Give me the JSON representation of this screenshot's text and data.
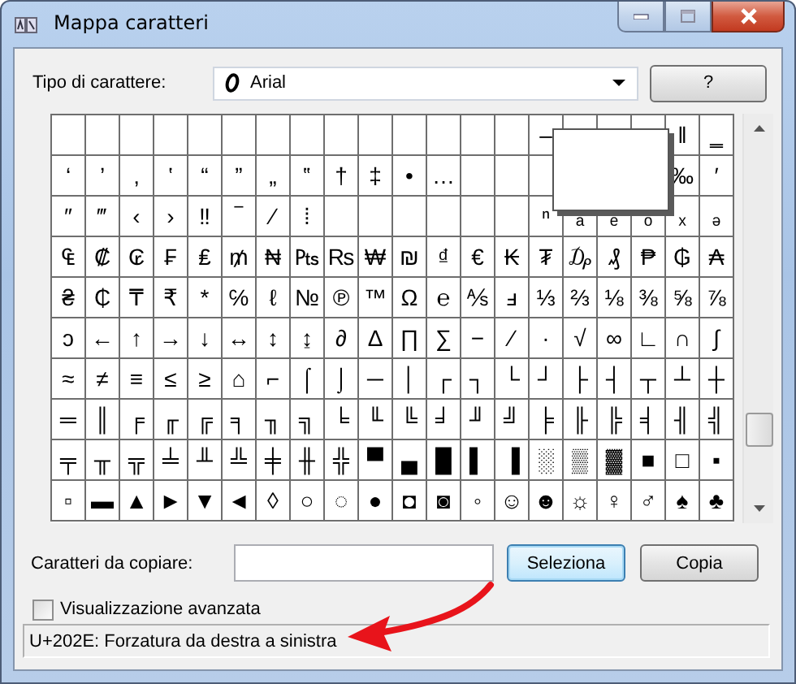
{
  "window": {
    "title": "Mappa caratteri"
  },
  "font": {
    "label": "Tipo di carattere:",
    "value": "Arial"
  },
  "help_button": "?",
  "grid": {
    "rows": [
      [
        null,
        null,
        null,
        null,
        null,
        null,
        null,
        null,
        null,
        null,
        null,
        null,
        null,
        null,
        "‒",
        null,
        null,
        null,
        "‖",
        "‗"
      ],
      [
        "‘",
        "’",
        "‚",
        "‛",
        "“",
        "”",
        "„",
        "‟",
        "†",
        "‡",
        "•",
        "…",
        null,
        null,
        null,
        null,
        null,
        null,
        "‰",
        "′"
      ],
      [
        "″",
        "‴",
        "‹",
        "›",
        "‼",
        "‾",
        "⁄",
        "⁞",
        null,
        null,
        null,
        null,
        null,
        null,
        "ⁿ",
        "ₐ",
        "ₑ",
        "ₒ",
        "ₓ",
        "ₔ"
      ],
      [
        "₠",
        "₡",
        "₢",
        "₣",
        "₤",
        "₥",
        "₦",
        "₧",
        "₨",
        "₩",
        "₪",
        "₫",
        "€",
        "₭",
        "₮",
        "₯",
        "₰",
        "₱",
        "₲",
        "₳"
      ],
      [
        "₴",
        "₵",
        "₸",
        "₹",
        "*",
        "℅",
        "ℓ",
        "№",
        "℗",
        "™",
        "Ω",
        "℮",
        "⅍",
        "ⅎ",
        "⅓",
        "⅔",
        "⅛",
        "⅜",
        "⅝",
        "⅞"
      ],
      [
        "ↄ",
        "←",
        "↑",
        "→",
        "↓",
        "↔",
        "↕",
        "↨",
        "∂",
        "∆",
        "∏",
        "∑",
        "−",
        "∕",
        "∙",
        "√",
        "∞",
        "∟",
        "∩",
        "∫"
      ],
      [
        "≈",
        "≠",
        "≡",
        "≤",
        "≥",
        "⌂",
        "⌐",
        "⌠",
        "⌡",
        "─",
        "│",
        "┌",
        "┐",
        "└",
        "┘",
        "├",
        "┤",
        "┬",
        "┴",
        "┼"
      ],
      [
        "═",
        "║",
        "╒",
        "╓",
        "╔",
        "╕",
        "╖",
        "╗",
        "╘",
        "╙",
        "╚",
        "╛",
        "╜",
        "╝",
        "╞",
        "╟",
        "╠",
        "╡",
        "╢",
        "╣"
      ],
      [
        "╤",
        "╥",
        "╦",
        "╧",
        "╨",
        "╩",
        "╪",
        "╫",
        "╬",
        "▀",
        "▄",
        "█",
        "▌",
        "▐",
        "░",
        "▒",
        "▓",
        "■",
        "□",
        "▪"
      ],
      [
        "▫",
        "▬",
        "▲",
        "►",
        "▼",
        "◄",
        "◊",
        "○",
        "◌",
        "●",
        "◘",
        "◙",
        "◦",
        "☺",
        "☻",
        "☼",
        "♀",
        "♂",
        "♠",
        "♣"
      ]
    ],
    "magnifier_shown": true
  },
  "copy": {
    "label": "Caratteri da copiare:"
  },
  "buttons": [
    {
      "label": "Seleziona",
      "focused": true
    },
    {
      "label": "Copia",
      "focused": false
    }
  ],
  "advanced": {
    "label": "Visualizzazione avanzata",
    "checked": false
  },
  "status_bar": "U+202E: Forzatura da destra a sinistra",
  "annotation": {
    "kind": "arrow"
  }
}
